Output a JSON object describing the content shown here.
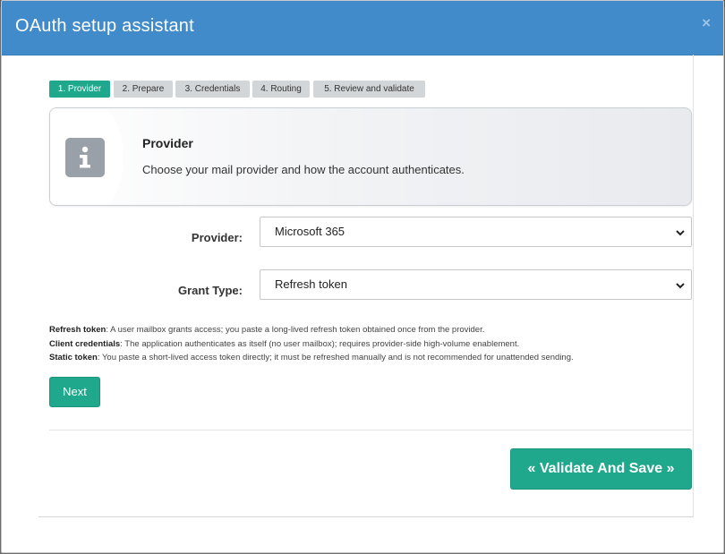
{
  "dialog": {
    "title": "OAuth setup assistant",
    "close_glyph": "×"
  },
  "steps": [
    {
      "label": "1. Provider",
      "active": true
    },
    {
      "label": "2. Prepare",
      "active": false
    },
    {
      "label": "3. Credentials",
      "active": false
    },
    {
      "label": "4. Routing",
      "active": false
    },
    {
      "label": "5. Review and validate",
      "active": false
    }
  ],
  "info_card": {
    "icon": "info-icon",
    "title": "Provider",
    "description": "Choose your mail provider and how the account authenticates."
  },
  "form": {
    "provider_label": "Provider:",
    "provider_value": "Microsoft 365",
    "grant_type_label": "Grant Type:",
    "grant_type_value": "Refresh token"
  },
  "help": [
    {
      "term": "Refresh token",
      "text": ": A user mailbox grants access; you paste a long-lived refresh token obtained once from the provider."
    },
    {
      "term": "Client credentials",
      "text": ": The application authenticates as itself (no user mailbox); requires provider-side high-volume enablement."
    },
    {
      "term": "Static token",
      "text": ": You paste a short-lived access token directly; it must be refreshed manually and is not recommended for unattended sending."
    }
  ],
  "buttons": {
    "next": "Next",
    "validate_save": "« Validate And Save »"
  },
  "colors": {
    "header": "#428bca",
    "accent": "#1fa88c",
    "step_inactive": "#d3d6d9"
  }
}
